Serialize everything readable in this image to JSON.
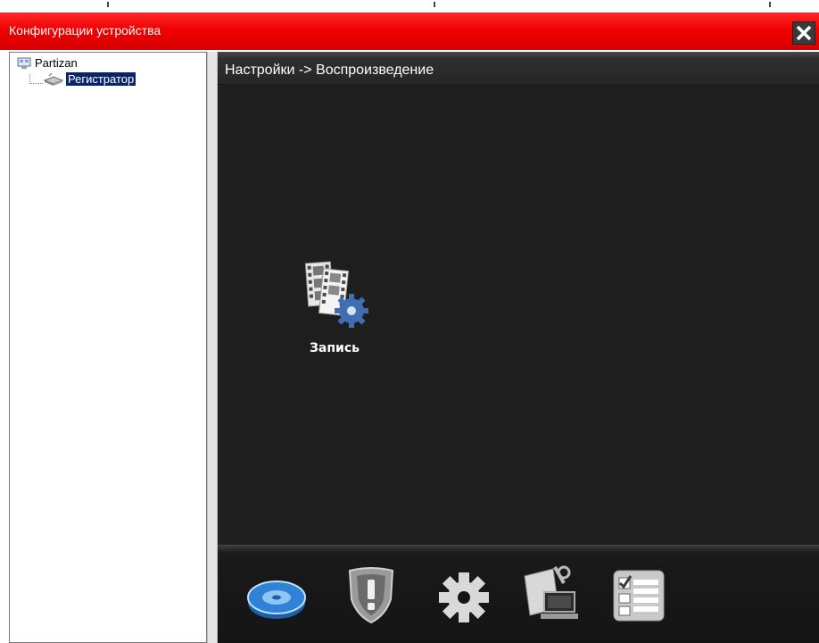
{
  "window": {
    "title": "Конфигурации устройства",
    "close_icon": "close-icon"
  },
  "tree": {
    "root": {
      "label": "Partizan",
      "icon": "network-root-icon"
    },
    "child": {
      "label": "Регистратор",
      "icon": "recorder-device-icon",
      "selected": true
    }
  },
  "panel": {
    "breadcrumb": "Настройки -> Воспроизведение",
    "items": [
      {
        "label": "Запись",
        "icon": "film-gear-icon"
      }
    ]
  },
  "toolbar": {
    "items": [
      {
        "icon": "hard-disk-icon",
        "active": true
      },
      {
        "icon": "alarm-shield-icon"
      },
      {
        "icon": "gear-icon"
      },
      {
        "icon": "network-tools-icon"
      },
      {
        "icon": "checklist-icon"
      }
    ]
  },
  "colors": {
    "titlebar": "#f00000",
    "panel_bg": "#1e1e1e",
    "selection": "#0a246a"
  }
}
